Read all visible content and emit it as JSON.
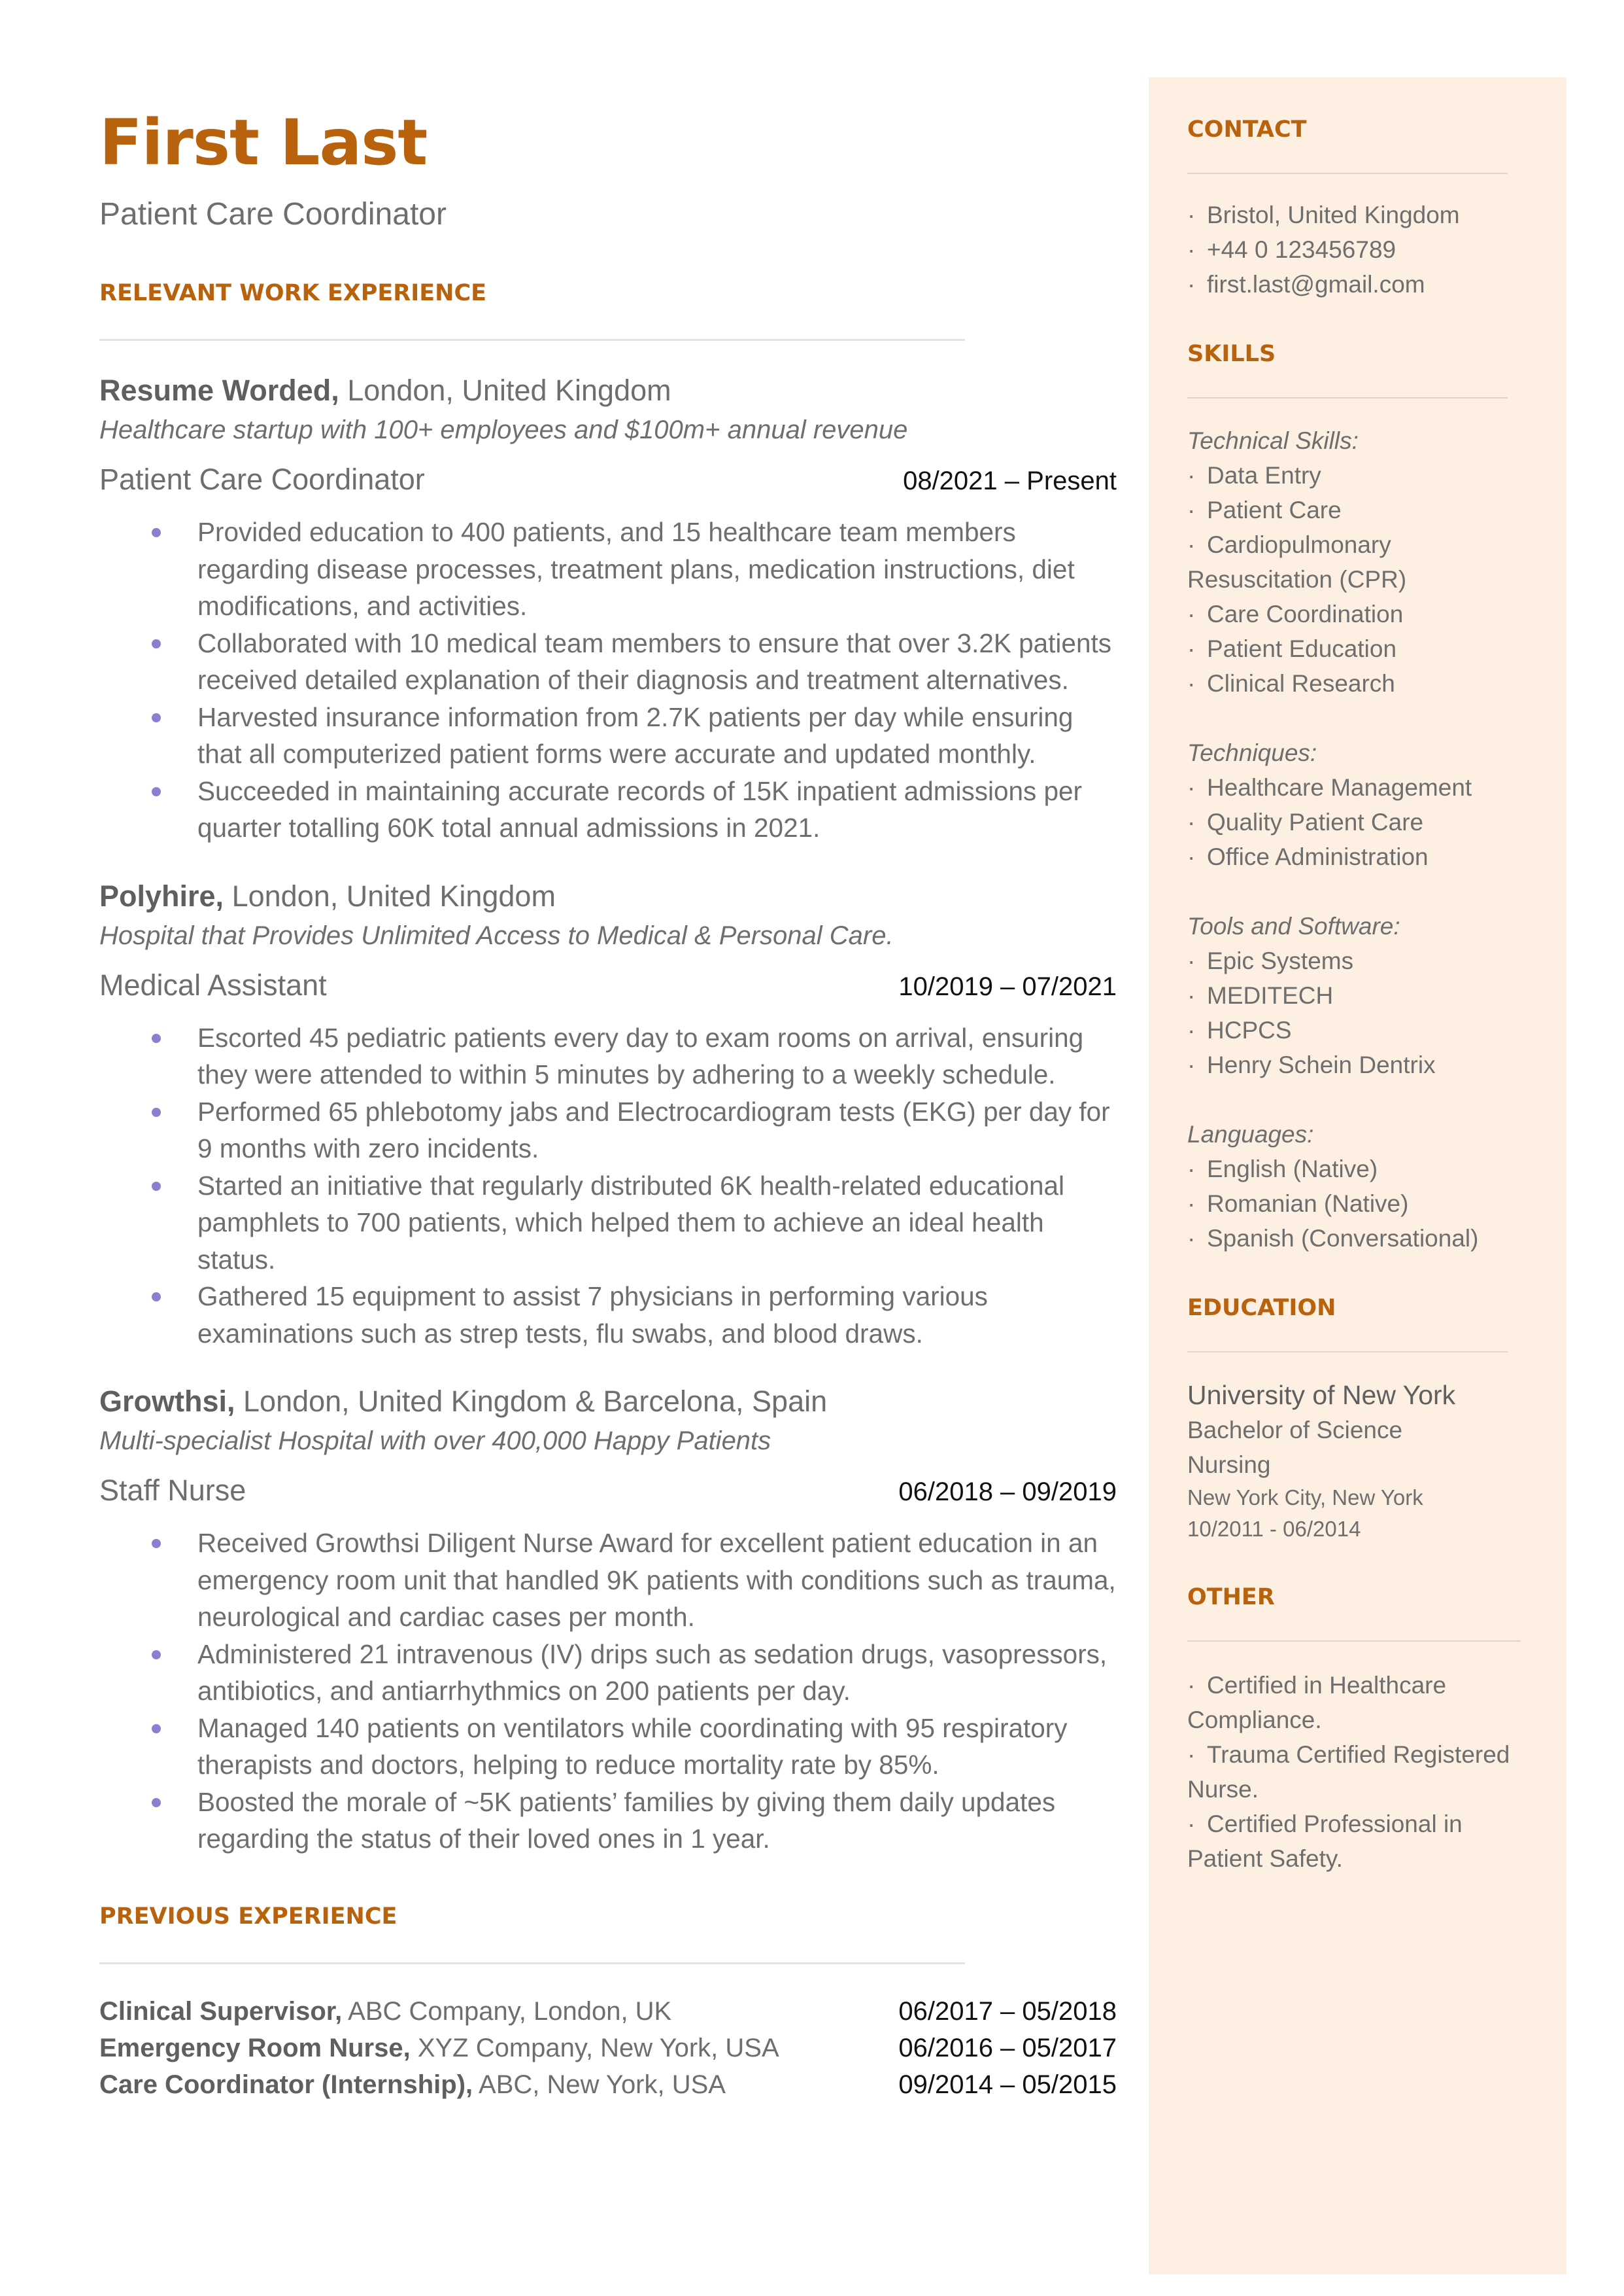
{
  "header": {
    "name": "First Last",
    "role": "Patient Care Coordinator"
  },
  "colors": {
    "accent": "#b8620e",
    "bullet": "#8a7fd0",
    "sidebar_bg": "#fdf0e3",
    "text": "#6e6e6e"
  },
  "experience": {
    "title": "RELEVANT WORK EXPERIENCE",
    "jobs": [
      {
        "company": "Resume Worded,",
        "location": " London, United Kingdom",
        "description": "Healthcare startup with 100+ employees and $100m+ annual revenue",
        "title": "Patient Care Coordinator",
        "dates": "08/2021 – Present",
        "bullets": [
          "Provided education to 400 patients, and 15 healthcare team members regarding disease processes, treatment plans, medication instructions, diet modifications, and activities.",
          "Collaborated with 10 medical team members to ensure that over 3.2K patients received detailed explanation of their diagnosis and treatment alternatives.",
          "Harvested insurance information from 2.7K patients per day while ensuring that all computerized patient forms were accurate and updated monthly.",
          "Succeeded in maintaining accurate records of 15K inpatient admissions per quarter totalling 60K total annual admissions in 2021."
        ]
      },
      {
        "company": "Polyhire,",
        "location": " London, United Kingdom",
        "description": "Hospital that Provides Unlimited Access to Medical & Personal Care.",
        "title": "Medical Assistant",
        "dates": "10/2019 – 07/2021",
        "bullets": [
          "Escorted 45 pediatric patients every day to exam rooms on arrival, ensuring they were attended to within 5 minutes by adhering to a weekly schedule.",
          "Performed 65 phlebotomy jabs and Electrocardiogram tests (EKG) per day for 9 months with zero incidents.",
          "Started an initiative that regularly distributed 6K health-related educational pamphlets to 700 patients, which helped them to achieve an ideal health status.",
          "Gathered 15 equipment to assist 7 physicians in performing various examinations such as strep tests, flu swabs, and blood draws."
        ]
      },
      {
        "company": "Growthsi,",
        "location": " London, United Kingdom & Barcelona, Spain",
        "description": "Multi-specialist Hospital with over 400,000 Happy Patients",
        "title": "Staff Nurse",
        "dates": "06/2018 – 09/2019",
        "bullets": [
          "Received Growthsi Diligent Nurse Award for excellent patient education in an emergency room unit that handled 9K patients with conditions such as trauma, neurological and cardiac cases per month.",
          "Administered 21 intravenous (IV) drips such as sedation drugs, vasopressors, antibiotics, and antiarrhythmics on 200 patients per day.",
          "Managed 140 patients on ventilators while coordinating with 95 respiratory therapists and doctors, helping to reduce mortality rate by 85%.",
          "Boosted the morale of ~5K patients’ families by giving them daily updates regarding the status of their loved ones in 1 year."
        ]
      }
    ]
  },
  "previous": {
    "title": "PREVIOUS EXPERIENCE",
    "items": [
      {
        "role": "Clinical Supervisor,",
        "org": " ABC Company, London, UK",
        "dates": "06/2017 – 05/2018"
      },
      {
        "role": "Emergency Room Nurse,",
        "org": " XYZ Company, New York, USA",
        "dates": "06/2016 – 05/2017"
      },
      {
        "role": "Care Coordinator (Internship),",
        "org": " ABC, New York, USA",
        "dates": "09/2014 – 05/2015"
      }
    ]
  },
  "sidebar": {
    "contact": {
      "title": "CONTACT",
      "items": [
        "Bristol, United Kingdom",
        "+44 0 123456789",
        "first.last@gmail.com"
      ]
    },
    "skills": {
      "title": "SKILLS",
      "groups": [
        {
          "label": "Technical Skills:",
          "items": [
            "Data Entry",
            "Patient Care",
            "Cardiopulmonary Resuscitation (CPR)",
            "Care Coordination",
            "Patient Education",
            "Clinical Research"
          ]
        },
        {
          "label": "Techniques:",
          "items": [
            "Healthcare Management",
            "Quality Patient Care",
            "Office Administration"
          ]
        },
        {
          "label": "Tools and Software:",
          "items": [
            "Epic Systems",
            "MEDITECH",
            "HCPCS",
            "Henry Schein Dentrix"
          ]
        },
        {
          "label": "Languages:",
          "items": [
            "English (Native)",
            "Romanian (Native)",
            "Spanish (Conversational)"
          ]
        }
      ]
    },
    "education": {
      "title": "EDUCATION",
      "school": "University of New York",
      "degree": "Bachelor of Science",
      "field": "Nursing",
      "location": "New York City, New York",
      "dates": "10/2011 - 06/2014"
    },
    "other": {
      "title": "OTHER",
      "items": [
        "Certified in Healthcare Compliance.",
        "Trauma Certified Registered Nurse.",
        "Certified Professional in Patient Safety."
      ]
    }
  }
}
